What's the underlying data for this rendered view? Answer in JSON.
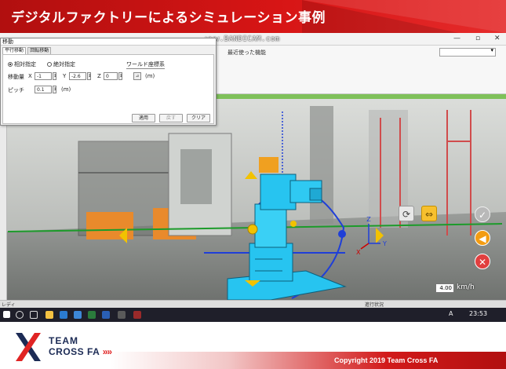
{
  "slide": {
    "title": "デジタルファクトリーによるシミュレーション事例",
    "copyright": "Copyright 2019 Team Cross FA",
    "logo": {
      "line1": "TEAM",
      "line2": "CROSS FA",
      "chevrons": "»»",
      "brand_red": "#e02424",
      "brand_navy": "#1c2b55"
    }
  },
  "app": {
    "watermark": "www.BANDICAM.com",
    "recent_label": "最近使った機能",
    "window_controls": {
      "minimize": "—",
      "maximize": "▫",
      "close": "✕"
    },
    "speed": {
      "value": "4.00",
      "unit": "km/h"
    },
    "status": {
      "ready": "レディ",
      "run_status": "進行状況"
    }
  },
  "dialog": {
    "title": "移動",
    "tabs": [
      {
        "label": "平行移動",
        "active": true
      },
      {
        "label": "回転移動",
        "active": false
      }
    ],
    "mode_relative": "相対指定",
    "mode_absolute": "絶対指定",
    "coord_system": "ワールド座標系",
    "move_amount_label": "移動量",
    "x": {
      "label": "X",
      "value": "-1"
    },
    "y": {
      "label": "Y",
      "value": "-2.6"
    },
    "z": {
      "label": "Z",
      "value": "0"
    },
    "unit": "(m)",
    "pitch_label": "ピッチ",
    "pitch_value": "0.1",
    "buttons": {
      "apply": "適用",
      "undo": "戻す",
      "clear": "クリア"
    }
  },
  "gizmo": {
    "x_axis": "X",
    "y_axis": "Y",
    "z_axis": "Z"
  },
  "colors": {
    "banner_red": "#d71515",
    "robot_cyan": "#27c4f0",
    "gizmo_blue": "#1f3fd8",
    "gizmo_yellow": "#f2c200"
  },
  "taskbar": {
    "time": "23:53",
    "lang": "A"
  }
}
